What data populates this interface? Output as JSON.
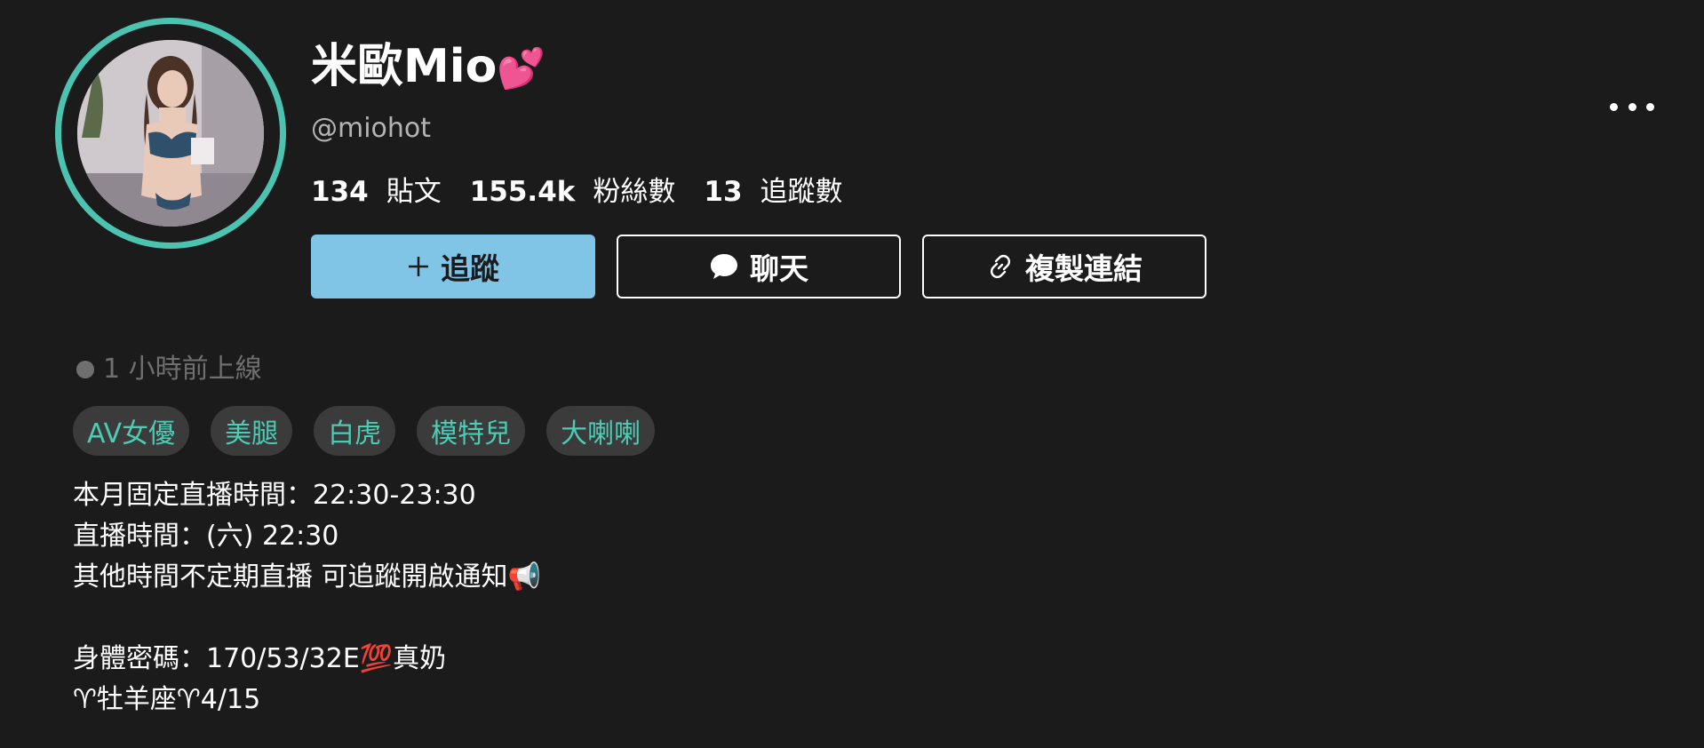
{
  "profile": {
    "display_name": "米歐Mio",
    "name_emoji": "💕",
    "handle": "@miohot"
  },
  "stats": {
    "posts": {
      "value": "134",
      "label": "貼文"
    },
    "followers": {
      "value": "155.4k",
      "label": "粉絲數"
    },
    "following": {
      "value": "13",
      "label": "追蹤數"
    }
  },
  "actions": {
    "follow_label": "追蹤",
    "chat_label": "聊天",
    "copy_link_label": "複製連結"
  },
  "status": {
    "online_text": "1 小時前上線"
  },
  "tags": [
    "AV女優",
    "美腿",
    "白虎",
    "模特兒",
    "大喇喇"
  ],
  "bio": {
    "line1": "本月固定直播時間：22:30-23:30",
    "line2": "直播時間：(六) 22:30",
    "line3": "其他時間不定期直播 可追蹤開啟通知📢",
    "line4": "身體密碼：170/53/32E💯真奶",
    "line5": "♈牡羊座♈4/15"
  },
  "colors": {
    "background": "#1b1b1c",
    "avatar_ring": "#4cc3b0",
    "follow_button": "#80c5e6",
    "tag_background": "#3b3b3c",
    "tag_text": "#4ecbb4",
    "muted_text": "#6f6f6f"
  },
  "icons": {
    "follow": "plus-icon",
    "chat": "chat-bubble-icon",
    "copy_link": "link-icon",
    "more": "more-horizontal-icon",
    "online": "status-dot-icon"
  }
}
